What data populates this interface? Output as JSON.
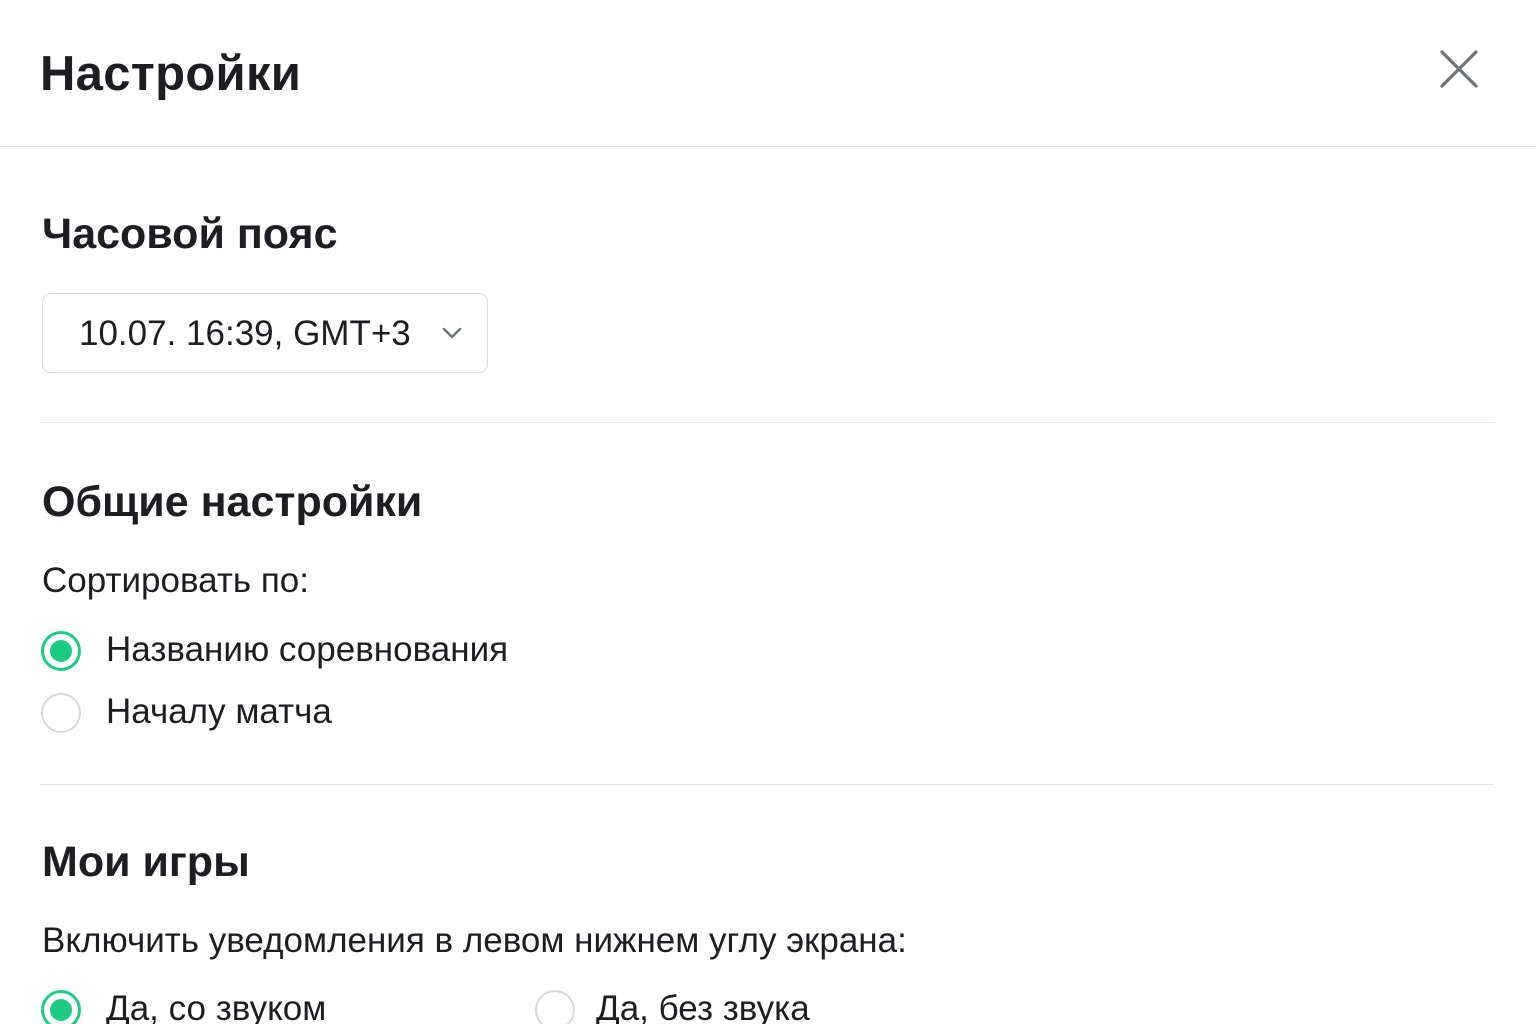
{
  "header": {
    "title": "Настройки",
    "close_icon": "close-icon"
  },
  "timezone": {
    "title": "Часовой пояс",
    "selected_value": "10.07. 16:39, GMT+3",
    "chevron_icon": "chevron-down-icon"
  },
  "general": {
    "title": "Общие настройки",
    "sort_label": "Сортировать по:",
    "sort_options": [
      {
        "label": "Названию соревнования",
        "checked": true
      },
      {
        "label": "Началу матча",
        "checked": false
      }
    ]
  },
  "my_games": {
    "title": "Мои игры",
    "notify_label": "Включить уведомления в левом нижнем углу экрана:",
    "notify_options": [
      {
        "label": "Да, со звуком",
        "checked": true
      },
      {
        "label": "Да, без звука",
        "checked": false
      }
    ]
  },
  "colors": {
    "accent": "#1ccc82",
    "text": "#1c1e21",
    "border": "#d8dadd",
    "divider": "#e3e4e6"
  }
}
